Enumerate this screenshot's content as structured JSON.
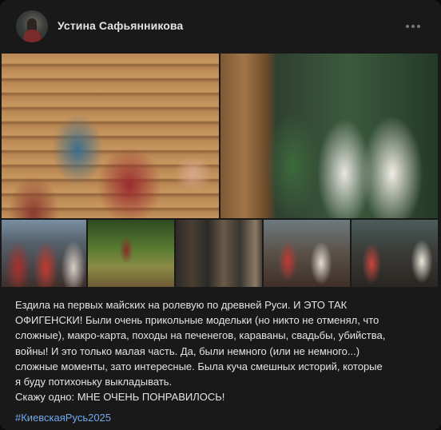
{
  "post": {
    "author": "Устина Сафьянникова",
    "menu_icon": "more-horizontal-icon",
    "photos": [
      "photo-1",
      "photo-2",
      "photo-3",
      "photo-4",
      "photo-5",
      "photo-6",
      "photo-7"
    ],
    "text_lines": [
      "Ездила на первых майских на ролевую по древней Руси. И ЭТО ТАК",
      "ОФИГЕНСКИ! Были очень прикольные модельки (но никто не отменял, что",
      "сложные), макро-карта, походы на печенегов, караваны, свадьбы, убийства,",
      "войны! И это только малая часть. Да, были немного (или не немного...)",
      "сложные моменты, зато интересные. Была куча смешных историй, которые",
      "я буду потихоньку выкладывать.",
      "Скажу одно: МНЕ ОЧЕНЬ ПОНРАВИЛОСЬ!"
    ],
    "hashtag": "#КиевскаяРусь2025",
    "colors": {
      "background": "#19191a",
      "text": "#e1e3e6",
      "link": "#71aaeb"
    }
  }
}
